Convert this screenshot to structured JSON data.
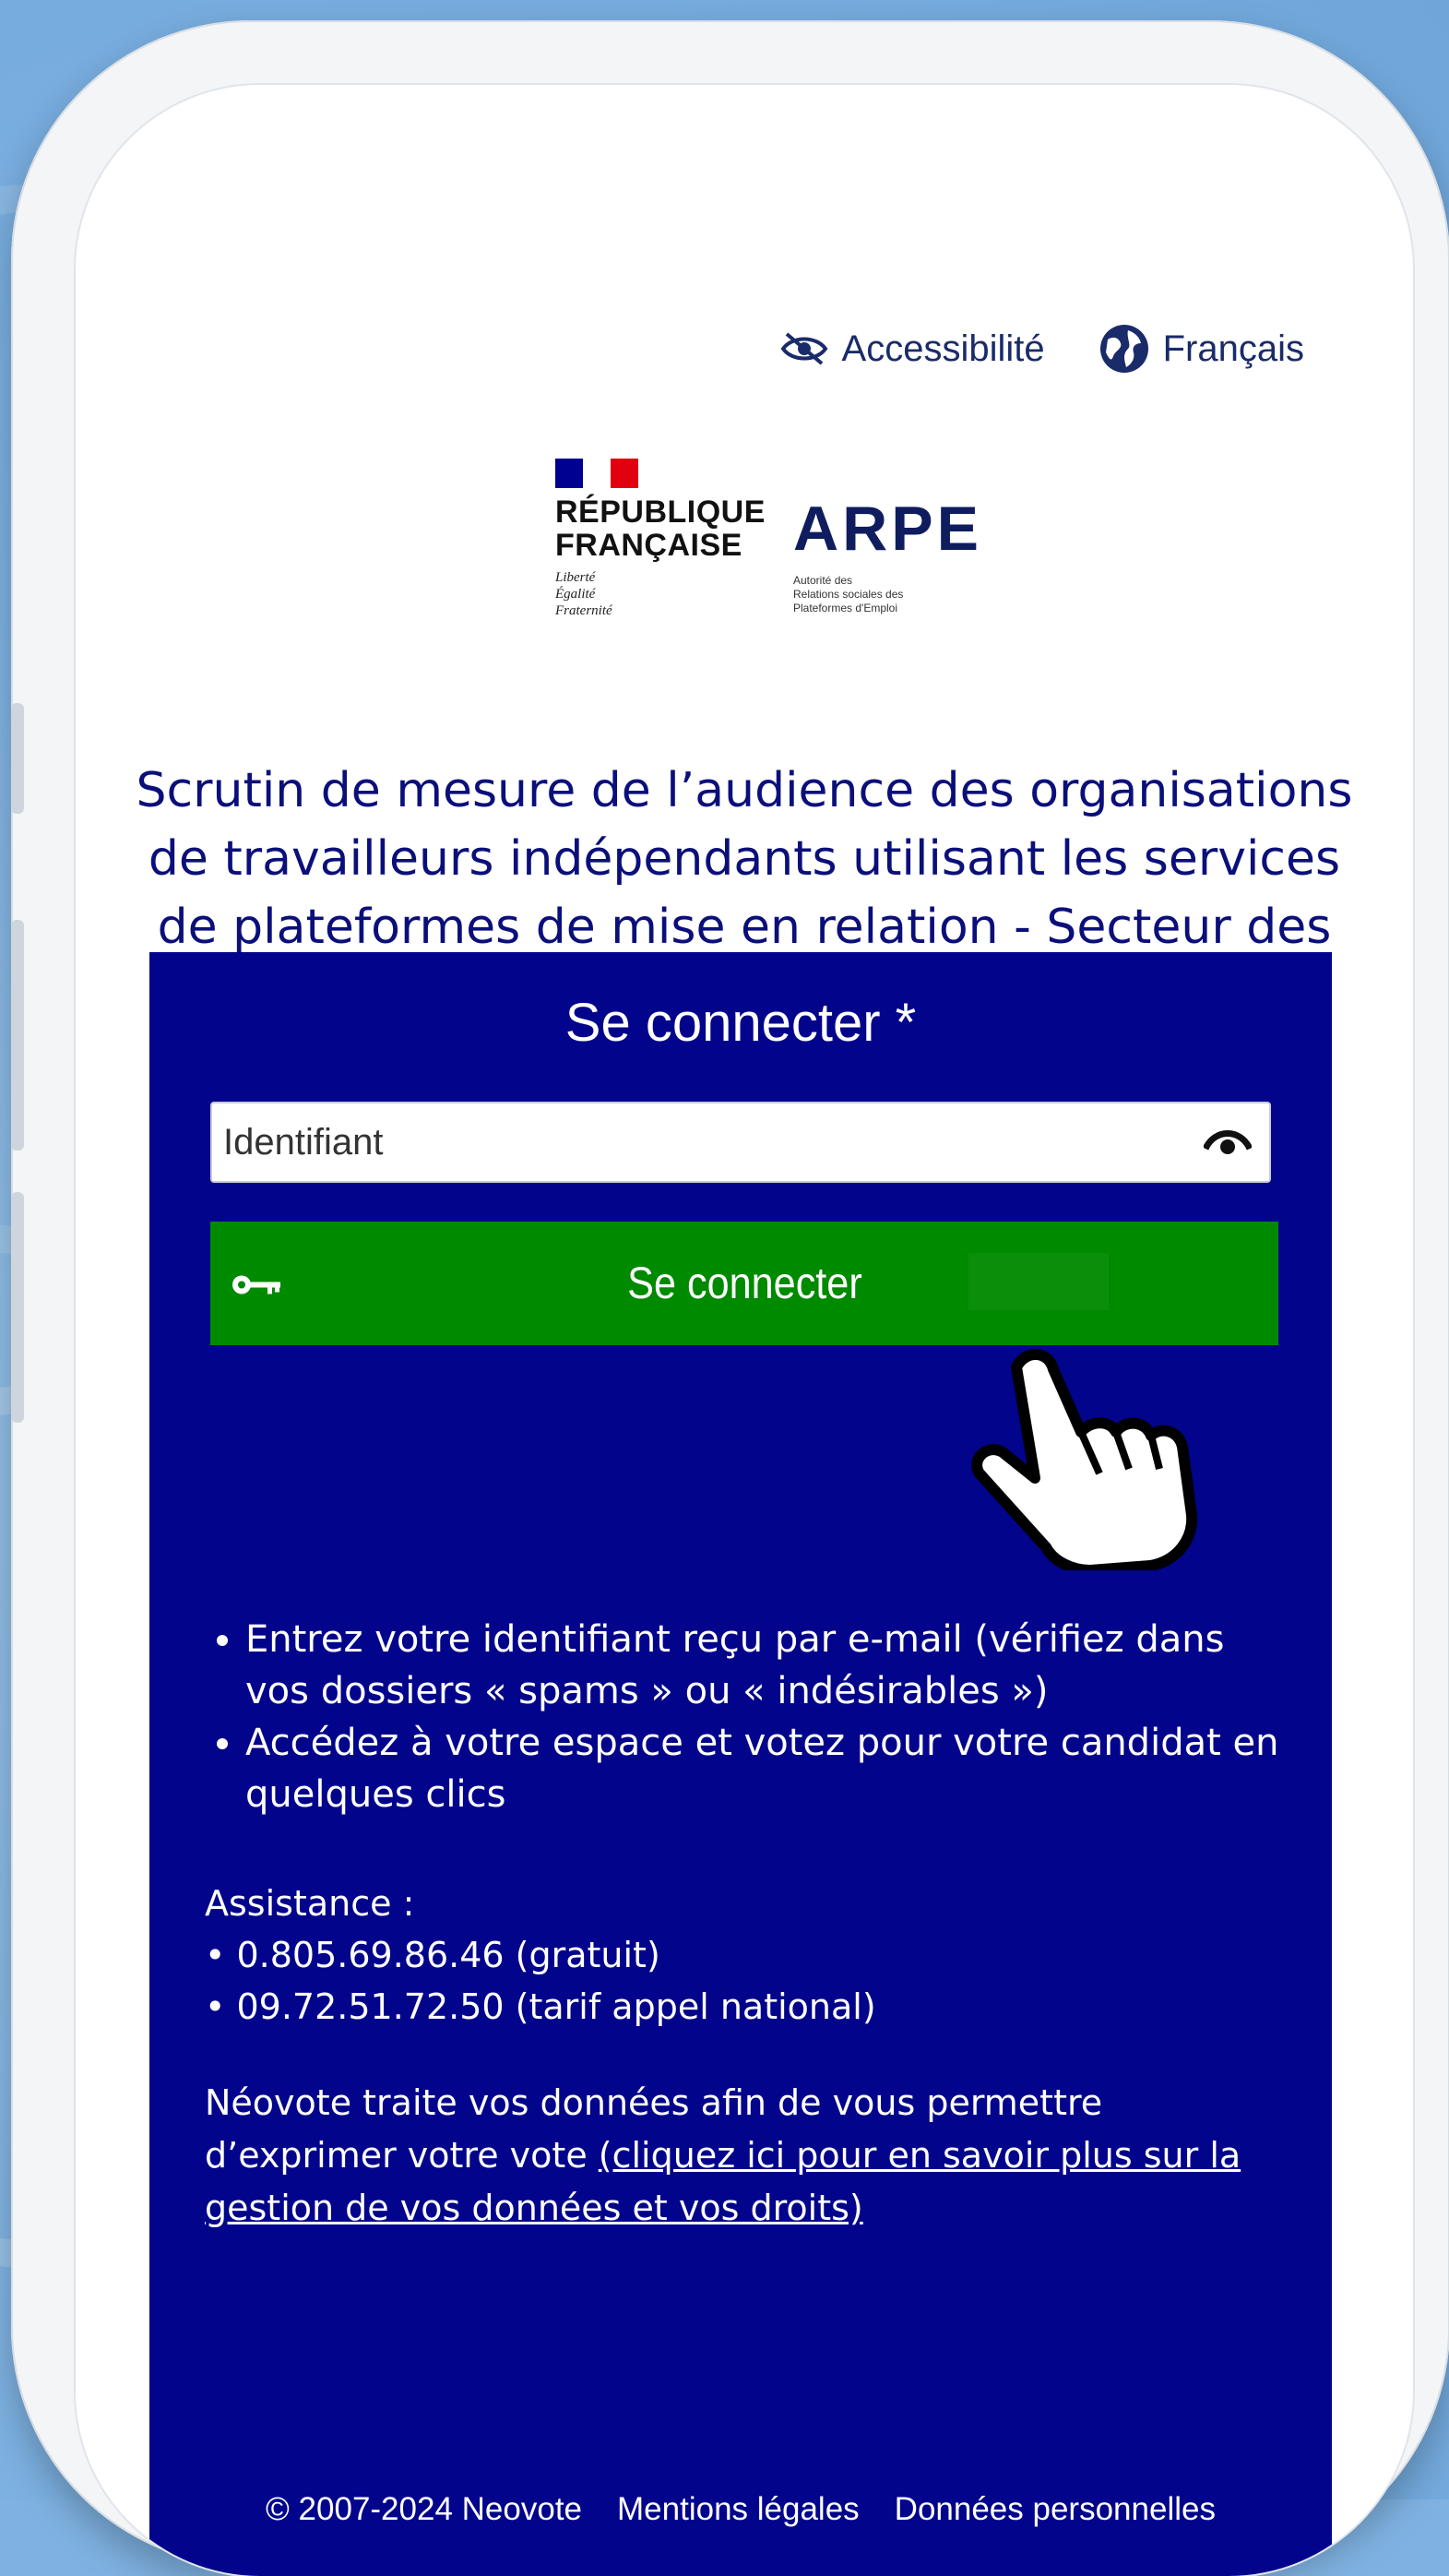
{
  "top_bar": {
    "accessibility_label": "Accessibilité",
    "language_label": "Français"
  },
  "logos": {
    "republique_line1": "RÉPUBLIQUE",
    "republique_line2": "FRANÇAISE",
    "motto_1": "Liberté",
    "motto_2": "Égalité",
    "motto_3": "Fraternité",
    "arpe_word": "ARPE",
    "arpe_sub_1": "Autorité des",
    "arpe_sub_2": "Relations sociales des",
    "arpe_sub_3": "Plateformes d'Emploi"
  },
  "page_title": "Scrutin de mesure de l’audience des organisations de travailleurs indépendants utilisant les services de plateformes de mise en relation - Secteur des livreurs",
  "login": {
    "heading": "Se connecter *",
    "identifier_placeholder": "Identifiant",
    "identifier_value": "",
    "submit_label": "Se connecter"
  },
  "instructions": [
    "Entrez votre identifiant reçu par e-mail (vérifiez dans vos dossiers « spams » ou « indésirables »)",
    "Accédez à votre espace et votez pour votre candidat en quelques clics"
  ],
  "assistance": {
    "label": "Assistance :",
    "line_1": "• 0.805.69.86.46 (gratuit)",
    "line_2": "• 09.72.51.72.50 (tarif appel national)"
  },
  "privacy": {
    "text": "Néovote traite vos données afin de vous permettre d’exprimer votre vote ",
    "link": "(cliquez ici pour en savoir plus sur la gestion de vos données et vos droits)"
  },
  "footer": {
    "copyright": "© 2007-2024 Neovote",
    "legal_link": "Mentions légales",
    "data_link": "Données personnelles"
  },
  "colors": {
    "panel_bg": "#02048b",
    "button_green": "#008a00",
    "title_blue": "#0a0f7a"
  }
}
